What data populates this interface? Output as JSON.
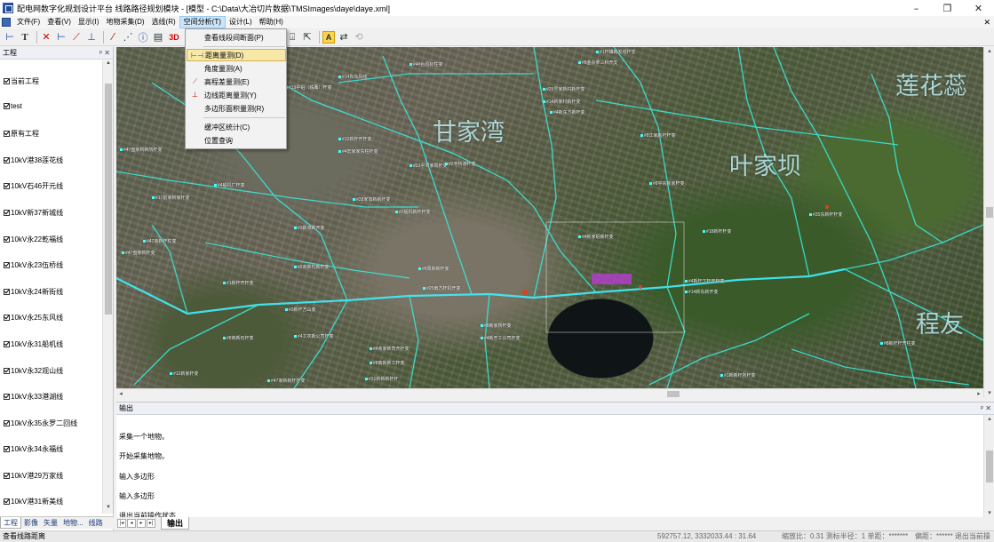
{
  "window": {
    "title": "配电网数字化规划设计平台 线路路径规划模块 - [模型 - C:\\Data\\大冶切片数据\\TMSImages\\daye\\daye.xml]",
    "buttons": [
      "–",
      "❐",
      "✕"
    ]
  },
  "menubar": {
    "items": [
      "文件(F)",
      "查看(V)",
      "显示(I)",
      "地物采集(D)",
      "选线(R)",
      "空间分析(T)",
      "设计(L)",
      "帮助(H)"
    ],
    "active_index": 5,
    "close": "✕"
  },
  "spatial_menu": {
    "items": [
      {
        "label": "查看线段间断面(P)",
        "icon": "",
        "icon_name": "none"
      },
      {
        "label": "距离量测(D)",
        "icon": "⊢⊣",
        "icon_name": "distance-measure-icon",
        "highlighted": true
      },
      {
        "label": "角度量测(A)",
        "icon": "",
        "icon_name": "none"
      },
      {
        "label": "高程差量测(E)",
        "icon": "⟋",
        "icon_name": "elevation-diff-icon"
      },
      {
        "label": "边线距离量测(Y)",
        "icon": "⊥",
        "icon_name": "edge-distance-icon"
      },
      {
        "label": "多边形面积量测(R)",
        "icon": "",
        "icon_name": "none"
      },
      {
        "label": "缓冲区统计(C)",
        "icon": "",
        "icon_name": "none"
      },
      {
        "label": "位置查询",
        "icon": "",
        "icon_name": "none"
      }
    ]
  },
  "left_panel": {
    "title": "工程",
    "header_buttons": "ᵖ ✕",
    "items": [
      "当前工程",
      "test",
      "原有工程",
      "10kV港38莲花线",
      "10kV石46开元线",
      "10kV新37新城线",
      "10kV永22乾福线",
      "10kV永23伍桥线",
      "10kV永24新街线",
      "10kV永25东风线",
      "10kV永31船机线",
      "10kV永32观山线",
      "10kV永33港湖线",
      "10kV永35永罗二回线",
      "10kV永34永福线",
      "10kV港29万家线",
      "10kV港31新美线"
    ],
    "tabs": [
      "工程",
      "影像",
      "矢量",
      "地物...",
      "线路"
    ]
  },
  "map": {
    "place_names": [
      "甘家湾",
      "叶家坝",
      "莲花蕊",
      "程友"
    ],
    "labels": [
      "#1杆镇新发线杆支",
      "#8金杂拿三科开支",
      "#4#台原标柱变",
      "#14东东风线",
      "#19中铝（铁鹰）杆变",
      "#25号家新村新杆变",
      "#14新家村新杆变",
      "#4新东方新杆变",
      "#8江家新杆杆变",
      "#12新杆开杆变",
      "#4宏家家东柱杆变",
      "#23中周家局杆变",
      "#47盘家新新所杆变",
      "#2丰桥港杆变",
      "#4船机厂杆变",
      "#17前家新家杆变",
      "#28家加新新杆变",
      "#2船机新杆杆变",
      "#8平宗新家杆变",
      "#3新城新开变",
      "#47商新杆柱变",
      "#47盘家新杆变",
      "#8周新新杆变",
      "#25南方杆机开变",
      "#2商新柱新杆变",
      "#1新杆开杆变",
      "#4工农新公司杆变",
      "#8商新石杆变",
      "#3新杆方山变",
      "#4商家新司开杆变",
      "#8商新新工杆变",
      "#12新家杆变",
      "#47家新新杆杆变",
      "#31新新新杆杆",
      "#8新家所杆变",
      "#4新开工公司杆变",
      "#18新杆杆变",
      "#4新家铝新杆变",
      "#25东新杆杆变",
      "#4新杆下杆开杆变",
      "#14新东新开变",
      "#8新杆杆开柱变",
      "#1新新杆所杆变"
    ]
  },
  "output": {
    "title": "输出",
    "header_buttons": "ᵖ ✕",
    "lines": [
      "采集一个地物。",
      "开始采集地物。",
      "输入多边形",
      "输入多边形",
      "退出当前操作状态..."
    ],
    "tab_label": "输出",
    "nav": [
      "|◂",
      "◂",
      "▸",
      "▸|"
    ]
  },
  "statusbar": {
    "left": "查看线路距离",
    "coords": "592757.12, 3332033.44 : 31.64",
    "scale": "缩放比：0.31 测标半径：1 单距：*******",
    "extra": "偏距：****** 退出当前操"
  }
}
